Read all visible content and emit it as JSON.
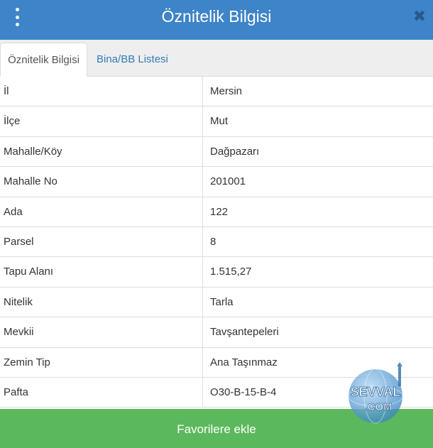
{
  "header": {
    "title": "Öznitelik Bilgisi",
    "close_label": "✖"
  },
  "tabs": [
    {
      "label": "Öznitelik Bilgisi"
    },
    {
      "label": "Bina/BB Listesi"
    }
  ],
  "attributes": [
    {
      "key": "İl",
      "value": "Mersin"
    },
    {
      "key": "İlçe",
      "value": "Mut"
    },
    {
      "key": "Mahalle/Köy",
      "value": "Dağpazarı"
    },
    {
      "key": "Mahalle No",
      "value": "201001"
    },
    {
      "key": "Ada",
      "value": "122"
    },
    {
      "key": "Parsel",
      "value": "8"
    },
    {
      "key": "Tapu Alanı",
      "value": "1.515,27"
    },
    {
      "key": "Nitelik",
      "value": "Tarla"
    },
    {
      "key": "Mevkii",
      "value": "Tavşantepeleri"
    },
    {
      "key": "Zemin Tip",
      "value": "Ana Taşınmaz"
    },
    {
      "key": "Pafta",
      "value": "O30-B-15-B-4"
    }
  ],
  "footer": {
    "favorite_label": "Favorilere ekle"
  },
  "watermark": {
    "text_top": "SEVVAL",
    "text_bottom": ".COM"
  },
  "colors": {
    "header": "#3d84c8",
    "accent_link": "#337ab7",
    "button": "#5cb85c"
  }
}
